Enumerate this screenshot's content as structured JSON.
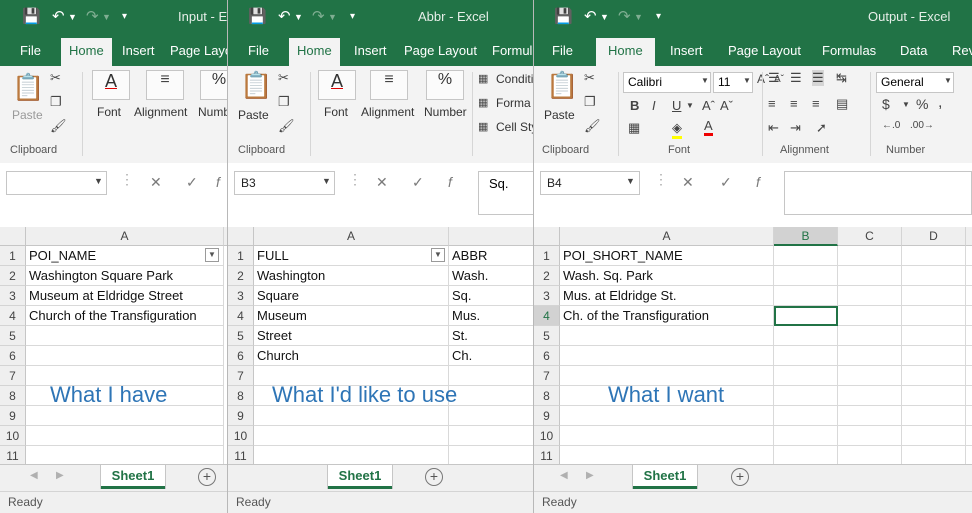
{
  "windows": [
    {
      "title": "Input  -  E",
      "tabs": [
        "File",
        "Home",
        "Insert",
        "Page Layout"
      ],
      "ribbon": {
        "clipboard": "Clipboard",
        "paste": "Paste",
        "font": "Font",
        "alignment": "Alignment",
        "number": "Numb"
      },
      "namebox": "",
      "formula": "",
      "columns": [
        "A"
      ],
      "row_numbers": [
        "1",
        "2",
        "3",
        "4",
        "5",
        "6",
        "7",
        "8",
        "9",
        "10",
        "11"
      ],
      "cells": [
        "POI_NAME",
        "Washington Square Park",
        "Museum at Eldridge Street",
        "Church of the Transfiguration"
      ],
      "note": "What I have",
      "sheet": "Sheet1",
      "status": "Ready"
    },
    {
      "title": "Abbr  -  Excel",
      "tabs": [
        "File",
        "Home",
        "Insert",
        "Page Layout",
        "Formula"
      ],
      "ribbon": {
        "clipboard": "Clipboard",
        "paste": "Paste",
        "font": "Font",
        "alignment": "Alignment",
        "number": "Number",
        "cond": "Conditi",
        "format": "Forma",
        "cellstyles": "Cell Sty"
      },
      "namebox": "B3",
      "formula": "Sq.",
      "columns": [
        "A"
      ],
      "row_numbers": [
        "1",
        "2",
        "3",
        "4",
        "5",
        "6",
        "7",
        "8",
        "9",
        "10",
        "11"
      ],
      "cells_a": [
        "FULL",
        "Washington",
        "Square",
        "Museum",
        "Street",
        "Church"
      ],
      "cells_b": [
        "ABBR",
        "Wash.",
        "Sq.",
        "Mus.",
        "St.",
        "Ch."
      ],
      "note": "What I'd like to use",
      "sheet": "Sheet1",
      "status": "Ready"
    },
    {
      "title": "Output  -  Excel",
      "tabs": [
        "File",
        "Home",
        "Insert",
        "Page Layout",
        "Formulas",
        "Data",
        "Rev"
      ],
      "ribbon": {
        "clipboard": "Clipboard",
        "paste": "Paste",
        "font": "Font",
        "font_name": "Calibri",
        "font_size": "11",
        "alignment": "Alignment",
        "number": "Number",
        "number_format": "General",
        "currency": "$",
        "percent": "%",
        "comma": ","
      },
      "namebox": "B4",
      "formula": "",
      "columns": [
        "A",
        "B",
        "C",
        "D"
      ],
      "row_numbers": [
        "1",
        "2",
        "3",
        "4",
        "5",
        "6",
        "7",
        "8",
        "9",
        "10",
        "11"
      ],
      "cells": [
        "POI_SHORT_NAME",
        "Wash. Sq. Park",
        "Mus. at Eldridge St.",
        "Ch. of the Transfiguration"
      ],
      "note": "What I want",
      "sheet": "Sheet1",
      "status": "Ready"
    }
  ],
  "icons": {
    "save": "save-icon",
    "undo": "undo-icon",
    "redo": "redo-icon",
    "customize": "customize-qat-icon",
    "fx": "fx-icon",
    "cancel": "cancel-icon",
    "confirm": "confirm-icon"
  },
  "colors": {
    "excel_green": "#217346",
    "note_blue": "#2e75b6"
  }
}
